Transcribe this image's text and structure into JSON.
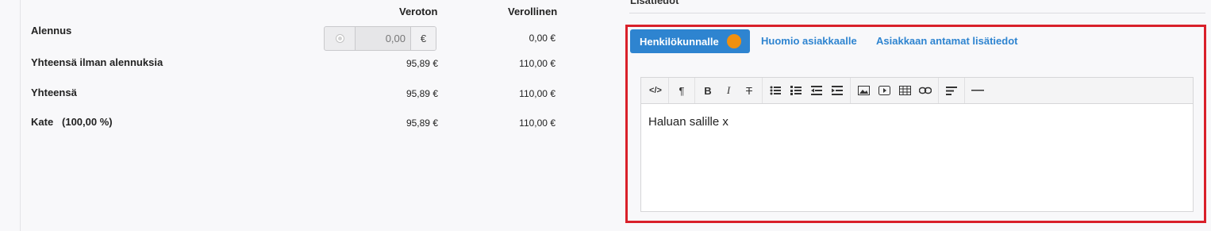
{
  "totals": {
    "columns": {
      "veroton": "Veroton",
      "verollinen": "Verollinen"
    },
    "discount": {
      "label": "Alennus",
      "input_value": "0,00",
      "unit": "€",
      "verollinen": "0,00 €"
    },
    "rows": [
      {
        "label": "Yhteensä ilman alennuksia",
        "veroton": "95,89 €",
        "verollinen": "110,00 €"
      },
      {
        "label": "Yhteensä",
        "veroton": "95,89 €",
        "verollinen": "110,00 €"
      },
      {
        "label": "Kate   (100,00 %)",
        "veroton": "95,89 €",
        "verollinen": "110,00 €"
      }
    ]
  },
  "notes": {
    "section_title": "Lisätiedot",
    "highlight_color": "#d9202a",
    "tabs": [
      {
        "label": "Henkilökunnalle",
        "active": true,
        "indicator_color": "#f0900f"
      },
      {
        "label": "Huomio asiakkaalle",
        "active": false
      },
      {
        "label": "Asiakkaan antamat lisätiedot",
        "active": false
      }
    ],
    "editor": {
      "toolbar": {
        "code_view": "</>",
        "paragraph": "¶",
        "bold": "B",
        "italic": "I",
        "strikethrough": "T"
      },
      "content": "Haluan salille x"
    }
  }
}
